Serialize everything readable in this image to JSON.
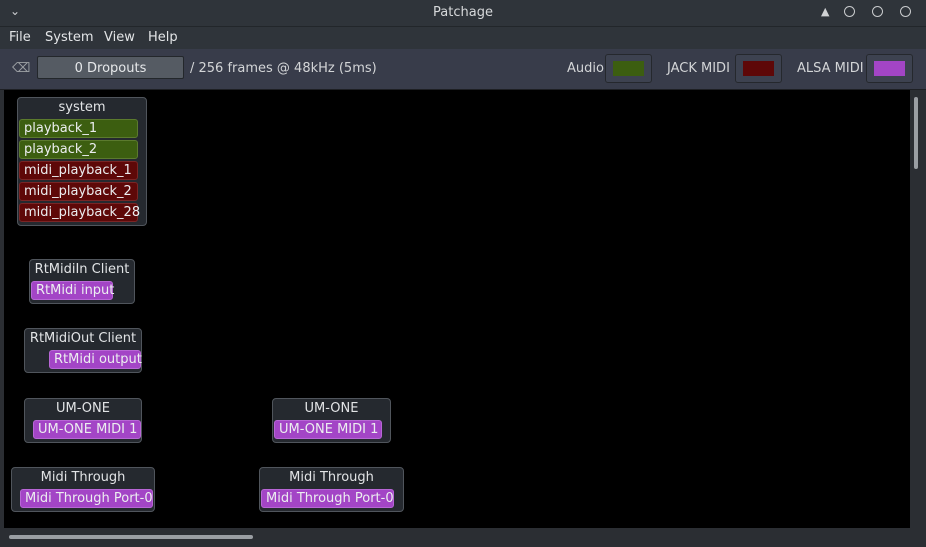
{
  "window": {
    "title": "Patchage"
  },
  "menu": {
    "file": "File",
    "system": "System",
    "view": "View",
    "help": "Help"
  },
  "toolbar": {
    "dropouts": "0 Dropouts",
    "frames": "/ 256 frames @ 48kHz (5ms)",
    "audio_label": "Audio",
    "jack_midi_label": "JACK MIDI",
    "alsa_midi_label": "ALSA MIDI"
  },
  "colors": {
    "audio": "#3c5e10",
    "jack_midi": "#5e0808",
    "alsa_midi": "#a345c6"
  },
  "modules": {
    "system": {
      "title": "system",
      "ports": [
        "playback_1",
        "playback_2",
        "midi_playback_1",
        "midi_playback_2",
        "midi_playback_28"
      ]
    },
    "rtmidi_in": {
      "title": "RtMidiIn Client",
      "ports": [
        "RtMidi input"
      ]
    },
    "rtmidi_out": {
      "title": "RtMidiOut Client",
      "ports": [
        "RtMidi output"
      ]
    },
    "umone_left": {
      "title": "UM-ONE",
      "ports": [
        "UM-ONE MIDI 1"
      ]
    },
    "umone_right": {
      "title": "UM-ONE",
      "ports": [
        "UM-ONE MIDI 1"
      ]
    },
    "midithrough_left": {
      "title": "Midi Through",
      "ports": [
        "Midi Through Port-0"
      ]
    },
    "midithrough_right": {
      "title": "Midi Through",
      "ports": [
        "Midi Through Port-0"
      ]
    }
  }
}
